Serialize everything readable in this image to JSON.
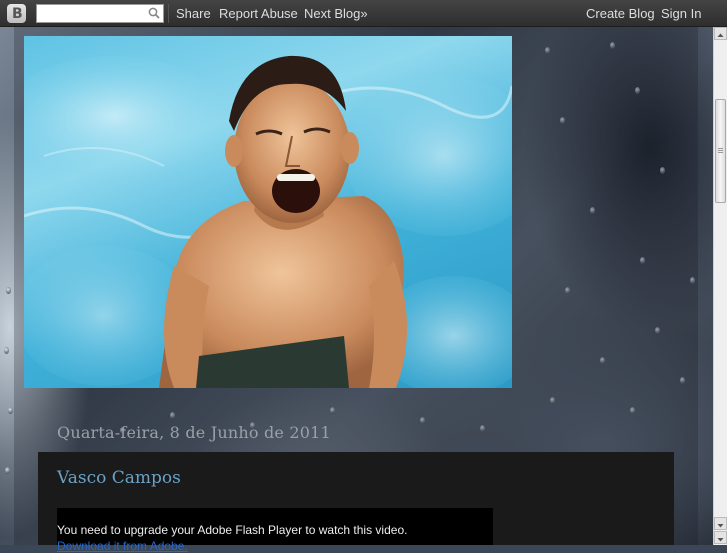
{
  "navbar": {
    "search_value": "",
    "share_label": "Share",
    "report_abuse_label": "Report Abuse",
    "next_blog_label": "Next Blog»",
    "create_blog_label": "Create Blog",
    "sign_in_label": "Sign In",
    "logo_letter": "B",
    "logo_icon": "blogger-logo-icon",
    "search_icon": "search-icon"
  },
  "blog": {
    "date_header": "Quarta-feira, 8 de Junho de 2011",
    "post": {
      "title": "Vasco Campos",
      "flash_message": "You need to upgrade your Adobe Flash Player to watch this video.",
      "flash_link": "Download it from Adobe."
    }
  },
  "colors": {
    "navbar_bg": "#383838",
    "nav_text": "#dddddd",
    "post_bg": "#1a1a1a",
    "post_title": "#6aa2c6",
    "date_text": "#9aa0a8",
    "link": "#2a66c4"
  }
}
